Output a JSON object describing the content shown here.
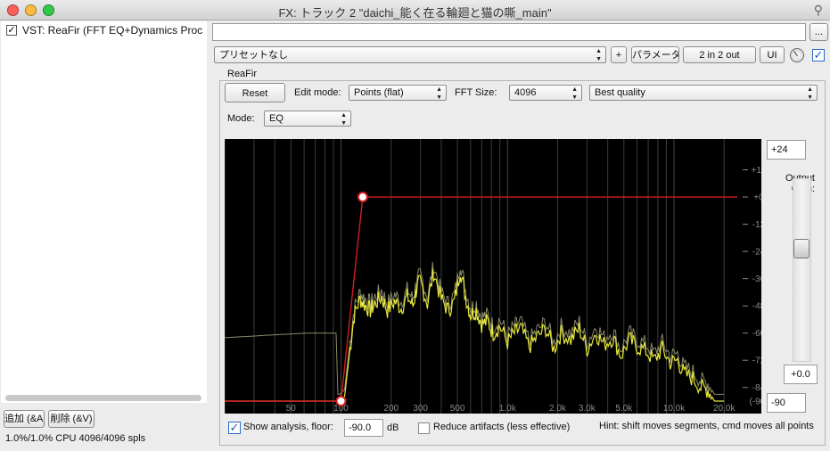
{
  "window": {
    "title": "FX: トラック 2 \"daichi_能く在る輪廻と猫の嘶_main\""
  },
  "fx_list": {
    "items": [
      {
        "label": "VST: ReaFir (FFT EQ+Dynamics Proc",
        "enabled": true
      }
    ],
    "add_button": "追加 (&A)",
    "remove_button": "削除 (&V)",
    "cpu_status": "1.0%/1.0% CPU 4096/4096 spls"
  },
  "top": {
    "browse_button": "...",
    "preset": "プリセットなし",
    "plus_button": "+",
    "params_button": "パラメータ",
    "io_button": "2 in 2 out",
    "ui_button": "UI"
  },
  "plugin": {
    "name": "ReaFir",
    "reset_button": "Reset",
    "edit_mode_label": "Edit mode:",
    "edit_mode": "Points (flat)",
    "fft_size_label": "FFT Size:",
    "fft_size": "4096",
    "quality": "Best quality",
    "mode_label": "Mode:",
    "mode": "EQ",
    "gain_top": "+24",
    "output_gain_label": "Output\nGain:",
    "gain_value": "+0.0",
    "gain_bottom": "-90",
    "show_analysis_label": "Show analysis, floor:",
    "show_analysis": true,
    "floor_value": "-90.0",
    "floor_unit": "dB",
    "reduce_artifacts_label": "Reduce artifacts (less effective)",
    "reduce_artifacts": false,
    "hint": "Hint: shift moves segments, cmd moves all points"
  },
  "chart_data": {
    "type": "line",
    "x_scale": "log",
    "xlim": [
      20,
      24000
    ],
    "ylim": [
      -90,
      24
    ],
    "x_tick_labels": [
      "50",
      "100",
      "200",
      "300",
      "500",
      "1.0k",
      "2.0k",
      "3.0k",
      "5.0k",
      "10.0k",
      "20.0k"
    ],
    "x_tick_values": [
      50,
      100,
      200,
      300,
      500,
      1000,
      2000,
      3000,
      5000,
      10000,
      20000
    ],
    "y_tick_labels": [
      "+12",
      "+0",
      "-12",
      "-24",
      "-36",
      "-48",
      "-60",
      "-72",
      "-84",
      "(-90)"
    ],
    "y_tick_values": [
      12,
      0,
      -12,
      -24,
      -36,
      -48,
      -60,
      -72,
      -84,
      -90
    ],
    "eq_points": [
      {
        "x": 100,
        "y": -90
      },
      {
        "x": 135,
        "y": 0
      }
    ],
    "eq_curve": {
      "x": [
        20,
        100,
        135,
        24000
      ],
      "y": [
        -90,
        -90,
        0,
        0
      ]
    },
    "colors": {
      "eq": "#d21e1e",
      "analysis": "#e8e83a",
      "analysis_shadow": "#8a8a6a",
      "grid": "#3c3c3c",
      "axis_text": "#8a8a8a"
    },
    "analysis": {
      "x": [
        20,
        60,
        85,
        98,
        105,
        112,
        120,
        130,
        140,
        150,
        160,
        175,
        190,
        210,
        230,
        250,
        270,
        285,
        300,
        330,
        360,
        400,
        440,
        480,
        520,
        560,
        600,
        650,
        700,
        760,
        820,
        900,
        1000,
        1100,
        1200,
        1350,
        1500,
        1700,
        1900,
        2100,
        2400,
        2700,
        3000,
        3400,
        3800,
        4300,
        4800,
        5400,
        6000,
        6800,
        7600,
        8500,
        9500,
        10500,
        11500,
        13000,
        14500,
        16000,
        17500,
        19000,
        20000
      ],
      "y": [
        -90,
        -90,
        -90,
        -90,
        -88,
        -70,
        -52,
        -45,
        -48,
        -50,
        -47,
        -44,
        -50,
        -46,
        -49,
        -44,
        -48,
        -40,
        -37,
        -47,
        -33,
        -45,
        -50,
        -46,
        -32,
        -44,
        -52,
        -50,
        -56,
        -55,
        -60,
        -57,
        -64,
        -60,
        -58,
        -66,
        -62,
        -58,
        -67,
        -60,
        -63,
        -58,
        -67,
        -60,
        -65,
        -62,
        -70,
        -63,
        -66,
        -68,
        -72,
        -67,
        -73,
        -72,
        -78,
        -80,
        -84,
        -85,
        -90,
        -90,
        -90
      ]
    }
  }
}
